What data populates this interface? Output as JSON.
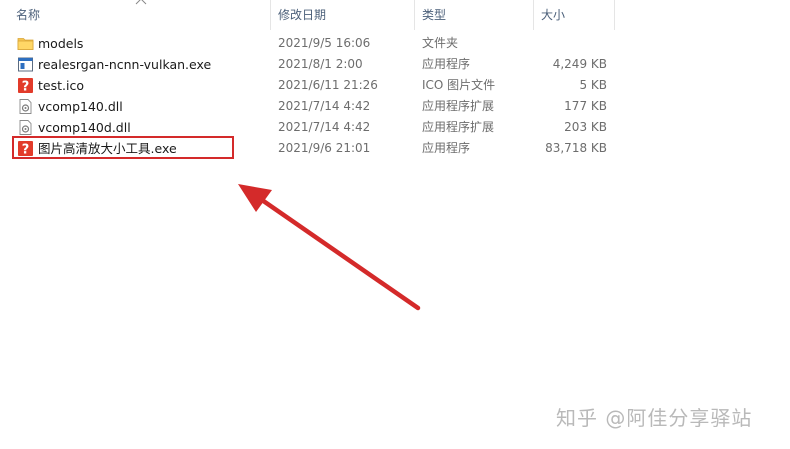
{
  "columns": {
    "name": "名称",
    "date": "修改日期",
    "type": "类型",
    "size": "大小"
  },
  "files": [
    {
      "icon": "folder-icon",
      "name": "models",
      "date": "2021/9/5 16:06",
      "type": "文件夹",
      "size": ""
    },
    {
      "icon": "exe-app-icon",
      "name": "realesrgan-ncnn-vulkan.exe",
      "date": "2021/8/1 2:00",
      "type": "应用程序",
      "size": "4,249 KB"
    },
    {
      "icon": "question-mark-icon",
      "name": "test.ico",
      "date": "2021/6/11 21:26",
      "type": "ICO 图片文件",
      "size": "5 KB"
    },
    {
      "icon": "dll-gear-file-icon",
      "name": "vcomp140.dll",
      "date": "2021/7/14 4:42",
      "type": "应用程序扩展",
      "size": "177 KB"
    },
    {
      "icon": "dll-gear-file-icon",
      "name": "vcomp140d.dll",
      "date": "2021/7/14 4:42",
      "type": "应用程序扩展",
      "size": "203 KB"
    },
    {
      "icon": "question-mark-icon",
      "name": "图片高清放大小工具.exe",
      "date": "2021/9/6 21:01",
      "type": "应用程序",
      "size": "83,718 KB"
    }
  ],
  "highlight_color": "#d42a2a",
  "watermark": "知乎 @阿佳分享驿站"
}
